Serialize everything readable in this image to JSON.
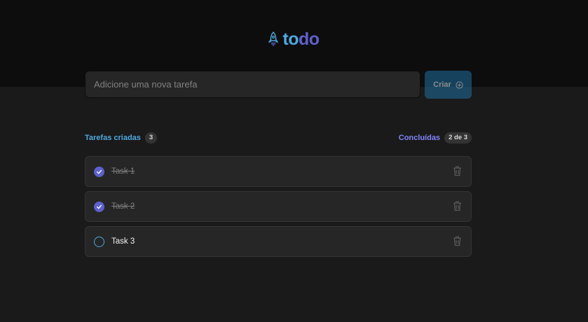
{
  "app": {
    "logo_part1": "to",
    "logo_part2": "do",
    "icon": "rocket-icon"
  },
  "new_task": {
    "placeholder": "Adicione uma nova tarefa",
    "value": "",
    "create_label": "Criar",
    "create_icon": "plus-circle-icon"
  },
  "counters": {
    "created_label": "Tarefas criadas",
    "created_count": "3",
    "done_label": "Concluídas",
    "done_count": "2 de 3"
  },
  "tasks": [
    {
      "label": "Task 1",
      "done": true
    },
    {
      "label": "Task 2",
      "done": true
    },
    {
      "label": "Task 3",
      "done": false
    }
  ],
  "colors": {
    "blue": "#4ea8de",
    "purple": "#5e60ce",
    "purple_light": "#8284fa",
    "header_bg": "#0d0d0d",
    "body_bg": "#1a1a1a",
    "card_bg": "#262626"
  }
}
